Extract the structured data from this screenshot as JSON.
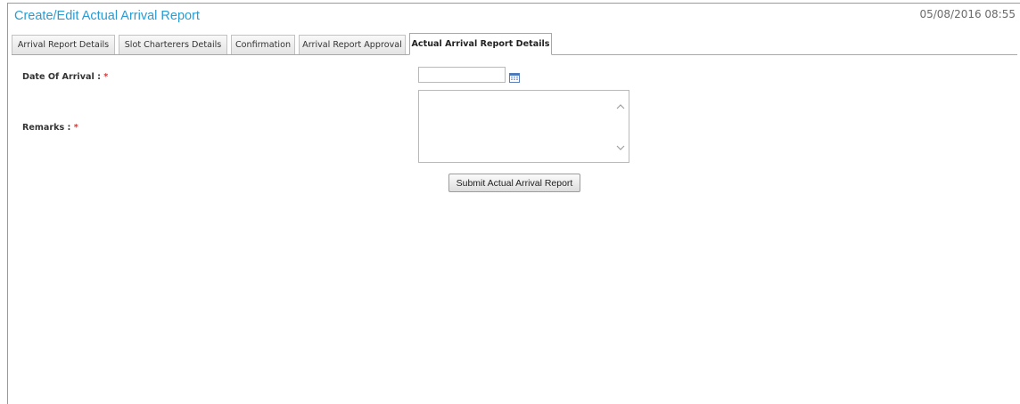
{
  "header": {
    "title": "Create/Edit Actual Arrival Report",
    "timestamp": "05/08/2016 08:55"
  },
  "tabs": [
    {
      "label": "Arrival Report Details",
      "active": false
    },
    {
      "label": "Slot Charterers Details",
      "active": false
    },
    {
      "label": "Confirmation",
      "active": false
    },
    {
      "label": "Arrival Report Approval",
      "active": false
    },
    {
      "label": "Actual Arrival Report Details",
      "active": true
    }
  ],
  "form": {
    "date_of_arrival": {
      "label": "Date Of Arrival :",
      "required_mark": "*",
      "value": "",
      "icon": "calendar-icon"
    },
    "remarks": {
      "label": "Remarks :",
      "required_mark": "*",
      "value": ""
    },
    "submit_label": "Submit Actual Arrival Report"
  },
  "colors": {
    "title": "#2b9bd1",
    "required": "#e23232",
    "border": "#9a9a9a"
  }
}
